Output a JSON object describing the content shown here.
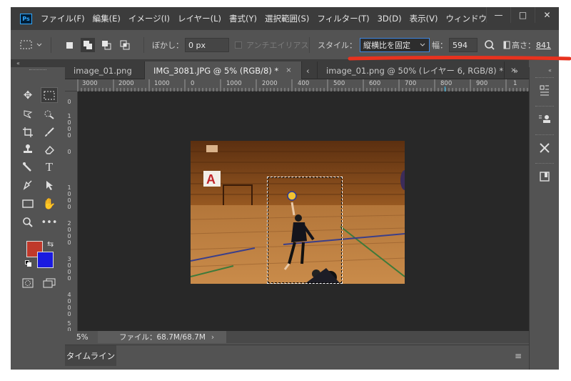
{
  "app": {
    "logo": "Ps"
  },
  "menu": [
    "ファイル(F)",
    "編集(E)",
    "イメージ(I)",
    "レイヤー(L)",
    "書式(Y)",
    "選択範囲(S)",
    "フィルター(T)",
    "3D(D)",
    "表示(V)",
    "ウィンドウ"
  ],
  "window_controls": {
    "minimize": "—",
    "maximize": "□",
    "close": "✕"
  },
  "options": {
    "feather_label": "ぼかし：",
    "feather_value": "0 px",
    "antialias_label": "アンチエイリアス",
    "style_label": "スタイル：",
    "style_value": "縦横比を固定",
    "width_label": "幅：",
    "width_value": "594",
    "height_label": "高さ：",
    "height_value": "841"
  },
  "tabs": [
    {
      "label": "image_01.png",
      "close": ""
    },
    {
      "label": "IMG_3081.JPG @ 5% (RGB/8) *",
      "close": "×"
    },
    {
      "label": "image_01.png @ 50% (レイヤー 6, RGB/8) *",
      "close": "×"
    }
  ],
  "tab_scroll": {
    "left": "‹",
    "right": "»"
  },
  "rulers": {
    "top": [
      "3000",
      "2000",
      "1000",
      "0",
      "1000",
      "2000",
      "3000",
      "400",
      "500",
      "600",
      "700",
      "800",
      "900",
      "1"
    ],
    "left": [
      "0",
      "1\n0\n0\n0",
      "0",
      "1\n0\n0\n0",
      "2\n0\n0\n0",
      "3\n0\n0\n0",
      "4\n0\n0\n0",
      "5\n0"
    ]
  },
  "photo": {
    "banner_letter": "A"
  },
  "status": {
    "zoom": "5%",
    "doc_info": "ファイル：68.7M/68.7M",
    "arrow": "›"
  },
  "timeline": {
    "label": "タイムライン"
  },
  "colors": {
    "foreground": "#c0392b",
    "background": "#1a1ae0",
    "accent": "#31a8ff",
    "annotation": "#e8321e"
  }
}
